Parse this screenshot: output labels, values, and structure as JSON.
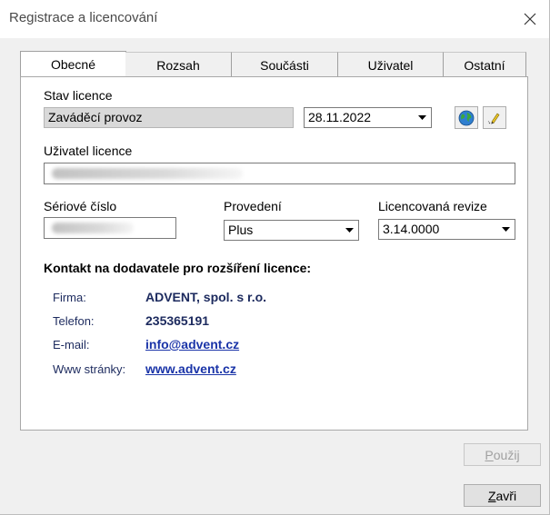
{
  "window": {
    "title": "Registrace a licencování",
    "close_label": "Close"
  },
  "tabs": [
    {
      "label": "Obecné",
      "active": true
    },
    {
      "label": "Rozsah",
      "active": false
    },
    {
      "label": "Součásti",
      "active": false
    },
    {
      "label": "Uživatel",
      "active": false
    },
    {
      "label": "Ostatní",
      "active": false
    }
  ],
  "license": {
    "status_label": "Stav licence",
    "status_value": "Zaváděcí provoz",
    "date_value": "28.11.2022",
    "user_label": "Uživatel licence",
    "user_value": "",
    "serial_label": "Sériové číslo",
    "serial_value": "",
    "edition_label": "Provedení",
    "edition_value": "Plus",
    "revision_label": "Licencovaná revize",
    "revision_value": "3.14.0000"
  },
  "contact": {
    "heading": "Kontakt na dodavatele pro rozšíření licence:",
    "company_label": "Firma:",
    "company_value": "ADVENT, spol. s r.o.",
    "phone_label": "Telefon:",
    "phone_value": "235365191",
    "email_label": "E-mail:",
    "email_value": "info@advent.cz",
    "web_label": "Www stránky:",
    "web_value": "www.advent.cz"
  },
  "buttons": {
    "apply": "Použij",
    "close": "Zavři"
  },
  "icons": {
    "web": "globe-icon",
    "edit": "pencil-icon",
    "close": "close-icon",
    "dropdown": "chevron-down-icon"
  },
  "colors": {
    "link": "#1a34a8",
    "contact_text": "#1c2a5e",
    "readonly_bg": "#d9d9d9"
  }
}
